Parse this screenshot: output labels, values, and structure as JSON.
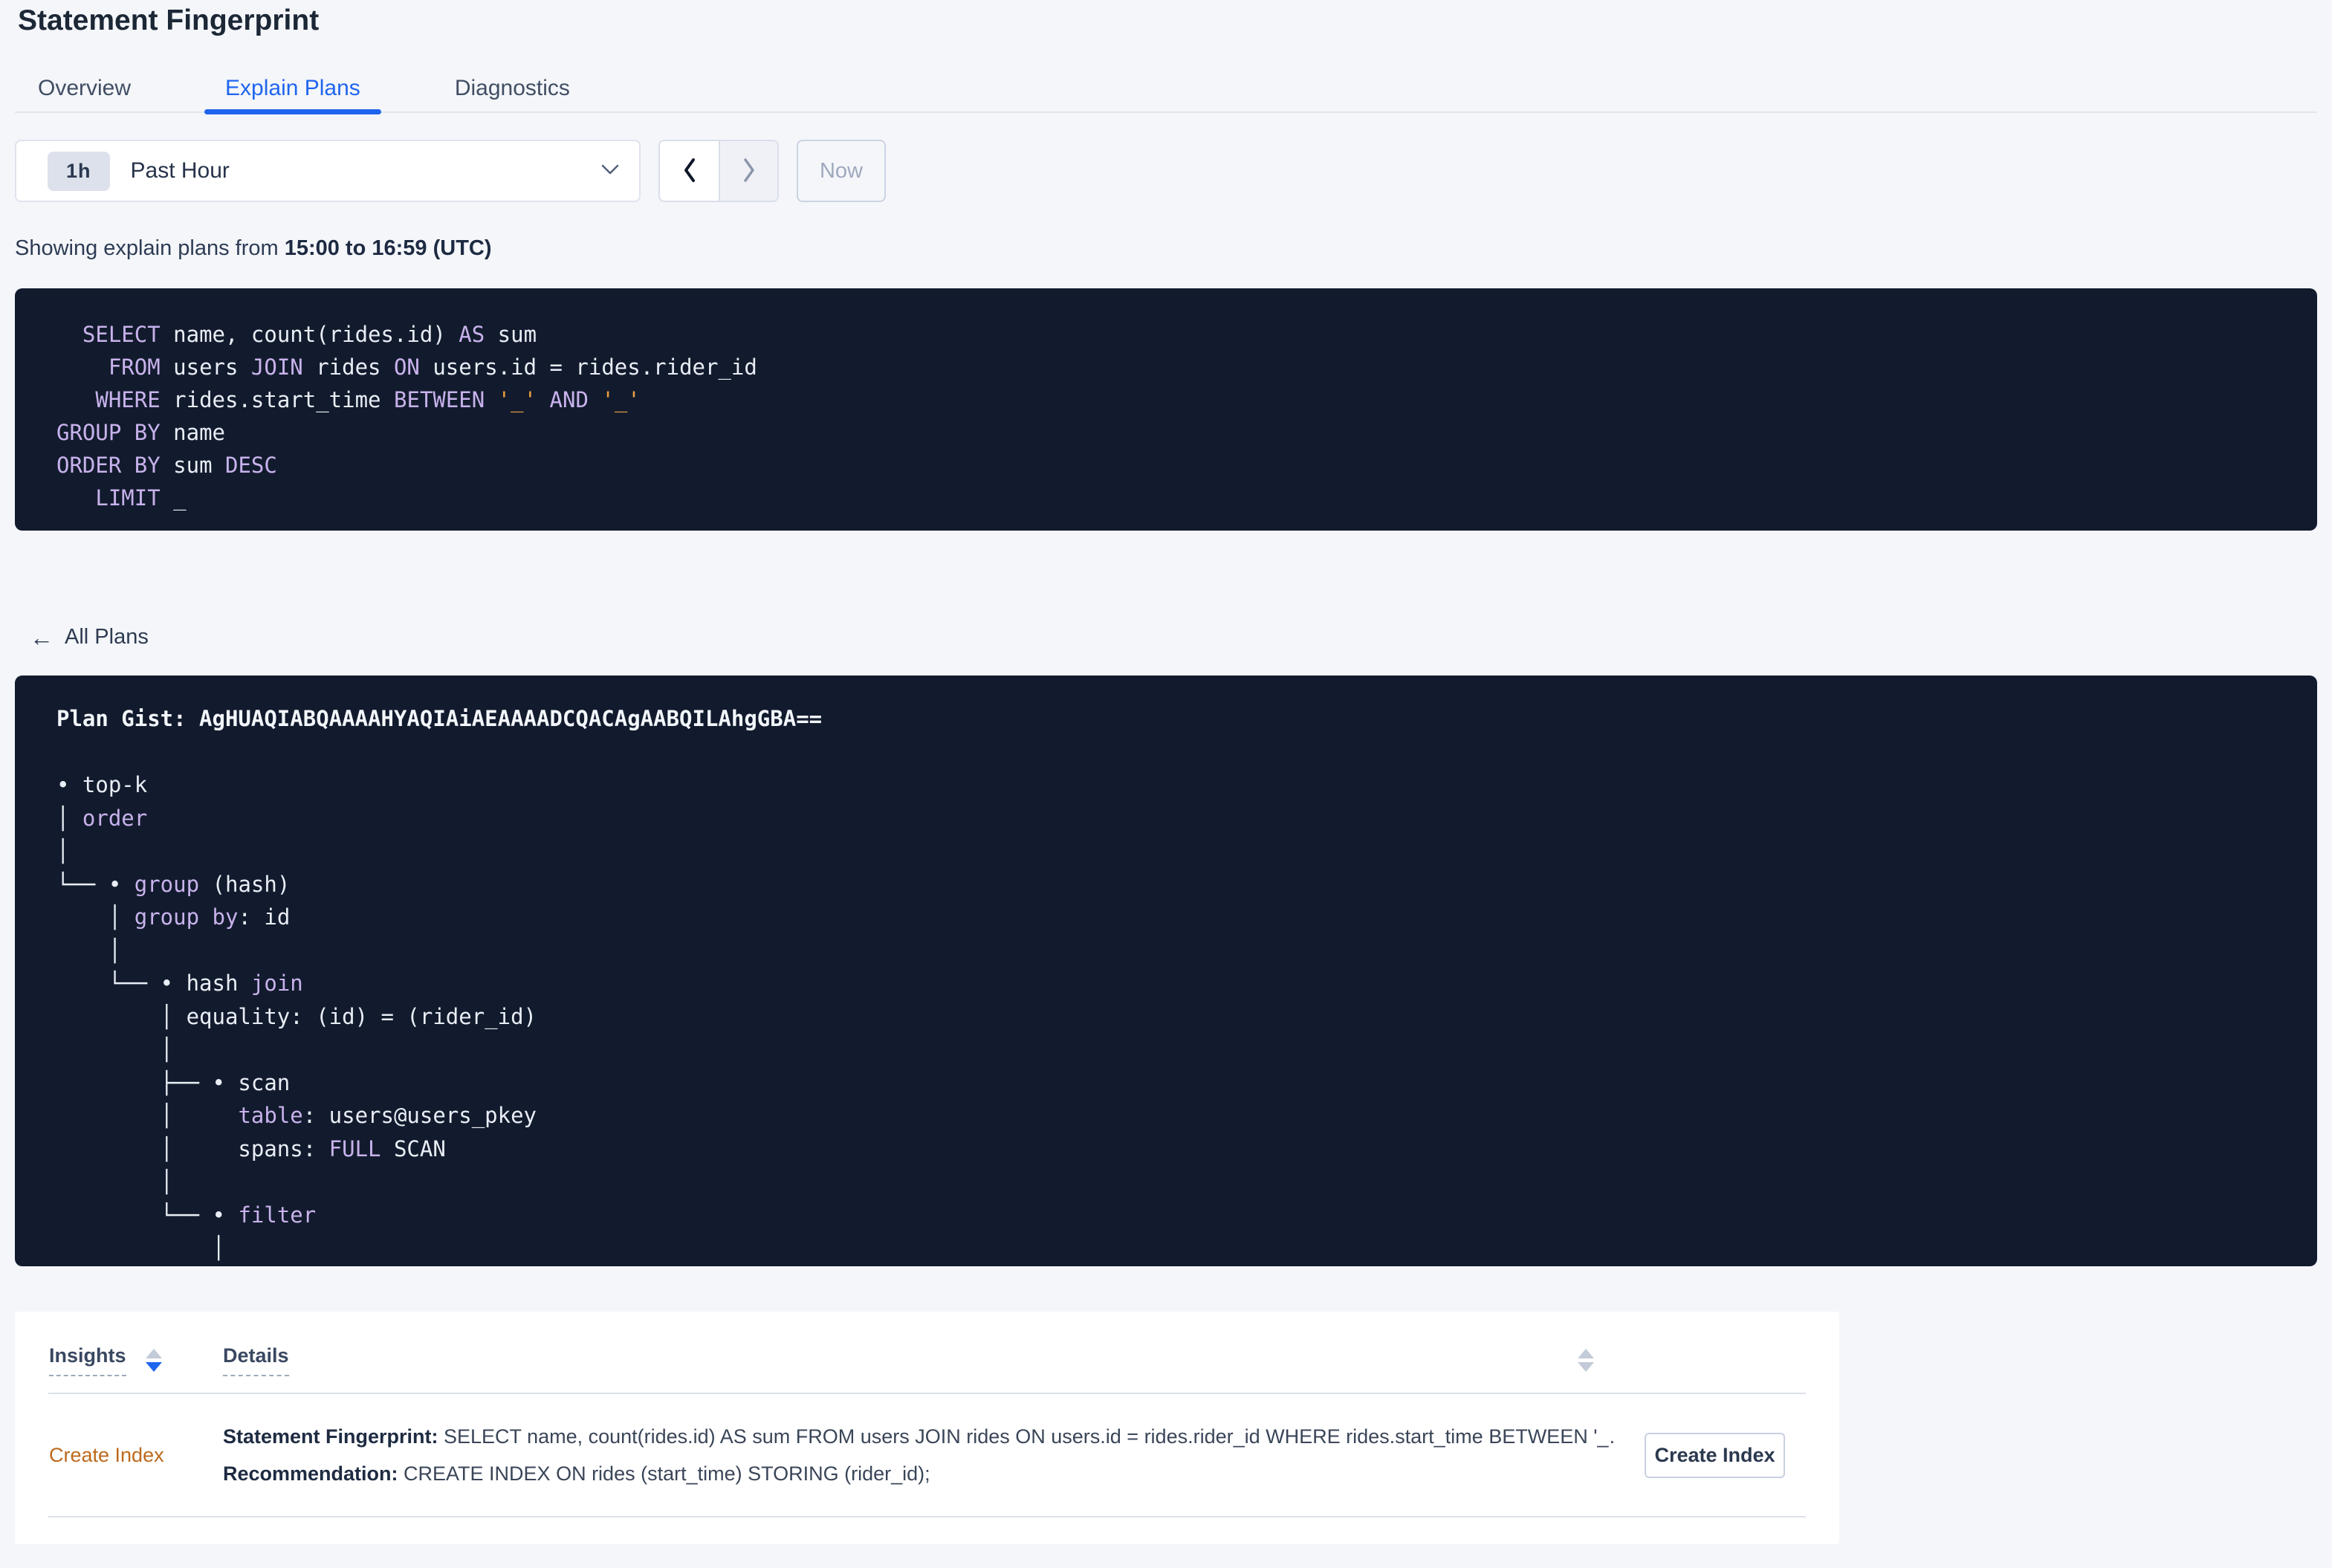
{
  "page": {
    "title": "Statement Fingerprint"
  },
  "tabs": [
    {
      "label": "Overview",
      "active": false
    },
    {
      "label": "Explain Plans",
      "active": true
    },
    {
      "label": "Diagnostics",
      "active": false
    }
  ],
  "time_selector": {
    "badge": "1h",
    "label": "Past Hour",
    "now_label": "Now"
  },
  "showing": {
    "prefix": "Showing explain plans from ",
    "range": "15:00 to 16:59 (UTC)"
  },
  "sql": {
    "lines": [
      [
        {
          "t": "  "
        },
        {
          "t": "SELECT",
          "c": "kw"
        },
        {
          "t": " name, count(rides.id) "
        },
        {
          "t": "AS",
          "c": "kw"
        },
        {
          "t": " sum"
        }
      ],
      [
        {
          "t": "    "
        },
        {
          "t": "FROM",
          "c": "kw"
        },
        {
          "t": " users "
        },
        {
          "t": "JOIN",
          "c": "kw"
        },
        {
          "t": " rides "
        },
        {
          "t": "ON",
          "c": "kw"
        },
        {
          "t": " users.id = rides.rider_id"
        }
      ],
      [
        {
          "t": "   "
        },
        {
          "t": "WHERE",
          "c": "kw"
        },
        {
          "t": " rides.start_time "
        },
        {
          "t": "BETWEEN",
          "c": "kw"
        },
        {
          "t": " "
        },
        {
          "t": "'_'",
          "c": "str"
        },
        {
          "t": " "
        },
        {
          "t": "AND",
          "c": "kw"
        },
        {
          "t": " "
        },
        {
          "t": "'_'",
          "c": "str"
        }
      ],
      [
        {
          "t": "GROUP BY",
          "c": "kw"
        },
        {
          "t": " name"
        }
      ],
      [
        {
          "t": "ORDER BY",
          "c": "kw"
        },
        {
          "t": " sum "
        },
        {
          "t": "DESC",
          "c": "kw"
        }
      ],
      [
        {
          "t": "   "
        },
        {
          "t": "LIMIT",
          "c": "kw"
        },
        {
          "t": " _"
        }
      ]
    ]
  },
  "back_link": {
    "label": "All Plans"
  },
  "plan": {
    "lines": [
      [
        {
          "t": "Plan Gist: AgHUAQIABQAAAAHYAQIAiAEAAAADCQACAgAABQILAhgGBA==",
          "c": "bold"
        }
      ],
      [
        {
          "t": " "
        }
      ],
      [
        {
          "t": "• top-k"
        }
      ],
      [
        {
          "t": "│ "
        },
        {
          "t": "order",
          "c": "kw"
        }
      ],
      [
        {
          "t": "│"
        }
      ],
      [
        {
          "t": "└── • "
        },
        {
          "t": "group",
          "c": "kw"
        },
        {
          "t": " (hash)"
        }
      ],
      [
        {
          "t": "    │ "
        },
        {
          "t": "group by",
          "c": "kw"
        },
        {
          "t": ": id"
        }
      ],
      [
        {
          "t": "    │"
        }
      ],
      [
        {
          "t": "    └── • hash "
        },
        {
          "t": "join",
          "c": "kw"
        }
      ],
      [
        {
          "t": "        │ equality: (id) = (rider_id)"
        }
      ],
      [
        {
          "t": "        │"
        }
      ],
      [
        {
          "t": "        ├── • scan"
        }
      ],
      [
        {
          "t": "        │     "
        },
        {
          "t": "table",
          "c": "kw"
        },
        {
          "t": ": users@users_pkey"
        }
      ],
      [
        {
          "t": "        │     spans: "
        },
        {
          "t": "FULL",
          "c": "kw"
        },
        {
          "t": " SCAN"
        }
      ],
      [
        {
          "t": "        │"
        }
      ],
      [
        {
          "t": "        └── • "
        },
        {
          "t": "filter",
          "c": "kw"
        }
      ],
      [
        {
          "t": "            │"
        }
      ],
      [
        {
          "t": "            │"
        }
      ]
    ]
  },
  "insights_table": {
    "columns": [
      {
        "label": "Insights"
      },
      {
        "label": "Details"
      }
    ],
    "row": {
      "insight": "Create Index",
      "detail1_label": "Statement Fingerprint:",
      "detail1_text": " SELECT name, count(rides.id) AS sum FROM users JOIN rides ON users.id = rides.rider_id WHERE rides.start_time BETWEEN '_…",
      "detail2_label": "Recommendation:",
      "detail2_text": " CREATE INDEX ON rides (start_time) STORING (rider_id);",
      "action_label": "Create Index"
    }
  }
}
